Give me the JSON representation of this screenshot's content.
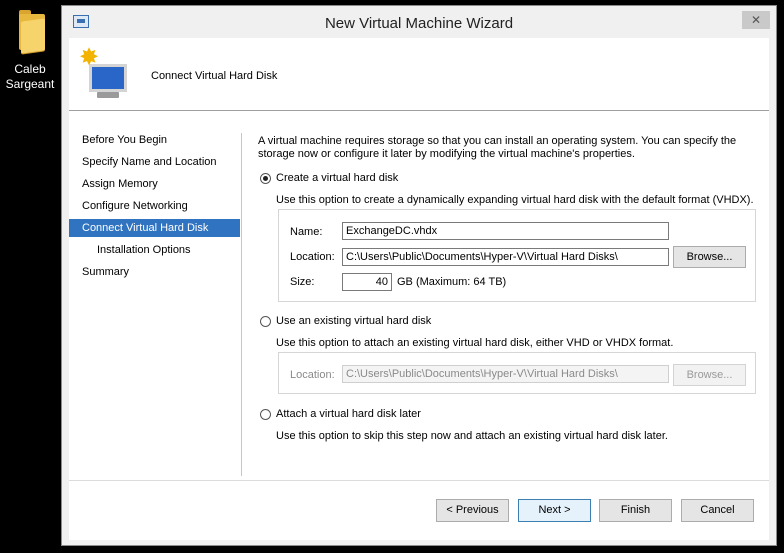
{
  "desktop": {
    "folder_label_line1": "Caleb",
    "folder_label_line2": "Sargeant"
  },
  "window": {
    "title": "New Virtual Machine Wizard",
    "close_glyph": "✕"
  },
  "header": {
    "page_title": "Connect Virtual Hard Disk"
  },
  "nav": {
    "items": [
      {
        "label": "Before You Begin"
      },
      {
        "label": "Specify Name and Location"
      },
      {
        "label": "Assign Memory"
      },
      {
        "label": "Configure Networking"
      },
      {
        "label": "Connect Virtual Hard Disk"
      },
      {
        "label": "Installation Options"
      },
      {
        "label": "Summary"
      }
    ],
    "selected_index": 4
  },
  "main": {
    "intro": "A virtual machine requires storage so that you can install an operating system. You can specify the storage now or configure it later by modifying the virtual machine's properties.",
    "create": {
      "label": "Create a virtual hard disk",
      "description": "Use this option to create a dynamically expanding virtual hard disk with the default format (VHDX).",
      "name_label": "Name:",
      "name_value": "ExchangeDC.vhdx",
      "location_label": "Location:",
      "location_value": "C:\\Users\\Public\\Documents\\Hyper-V\\Virtual Hard Disks\\",
      "browse_label": "Browse...",
      "size_label": "Size:",
      "size_value": "40",
      "size_note": "GB (Maximum: 64 TB)"
    },
    "existing": {
      "label": "Use an existing virtual hard disk",
      "description": "Use this option to attach an existing virtual hard disk, either VHD or VHDX format.",
      "location_label": "Location:",
      "location_value": "C:\\Users\\Public\\Documents\\Hyper-V\\Virtual Hard Disks\\",
      "browse_label": "Browse..."
    },
    "later": {
      "label": "Attach a virtual hard disk later",
      "description": "Use this option to skip this step now and attach an existing virtual hard disk later."
    }
  },
  "footer": {
    "previous_label": "< Previous",
    "next_label": "Next >",
    "finish_label": "Finish",
    "cancel_label": "Cancel"
  }
}
